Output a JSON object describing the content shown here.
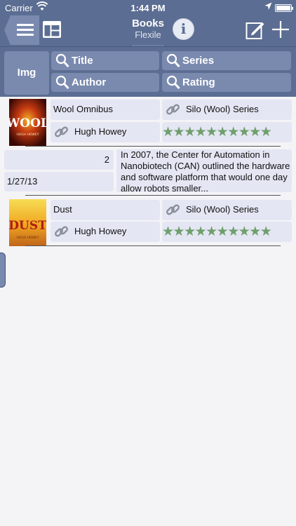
{
  "status": {
    "carrier": "Carrier",
    "time": "1:44 PM"
  },
  "nav": {
    "title": "Books",
    "subtitle": "Flexile"
  },
  "header": {
    "img_label": "Img",
    "title_label": "Title",
    "series_label": "Series",
    "author_label": "Author",
    "rating_label": "Rating"
  },
  "books": [
    {
      "title": "Wool Omnibus",
      "series": "Silo (Wool) Series",
      "author": "Hugh Howey",
      "rating": 10,
      "stars": "★★★★★★★★★★",
      "count": "2",
      "date": "1/27/13",
      "description": "In 2007, the Center for Automation in Nanobiotech (CAN) outlined the hardware and software platform that would one day allow robots smaller...",
      "cover_text": "WOOL",
      "cover_subtext": "HUGH HOWEY"
    },
    {
      "title": "Dust",
      "series": "Silo (Wool) Series",
      "author": "Hugh Howey",
      "rating": 10,
      "stars": "★★★★★★★★★★",
      "cover_text": "DUST",
      "cover_subtext": "HUGH HOWEY"
    }
  ],
  "colors": {
    "bar": "#5b6d92",
    "button": "#7a8aaf",
    "cell": "#e4e6f3",
    "star": "#6f9f6c"
  }
}
